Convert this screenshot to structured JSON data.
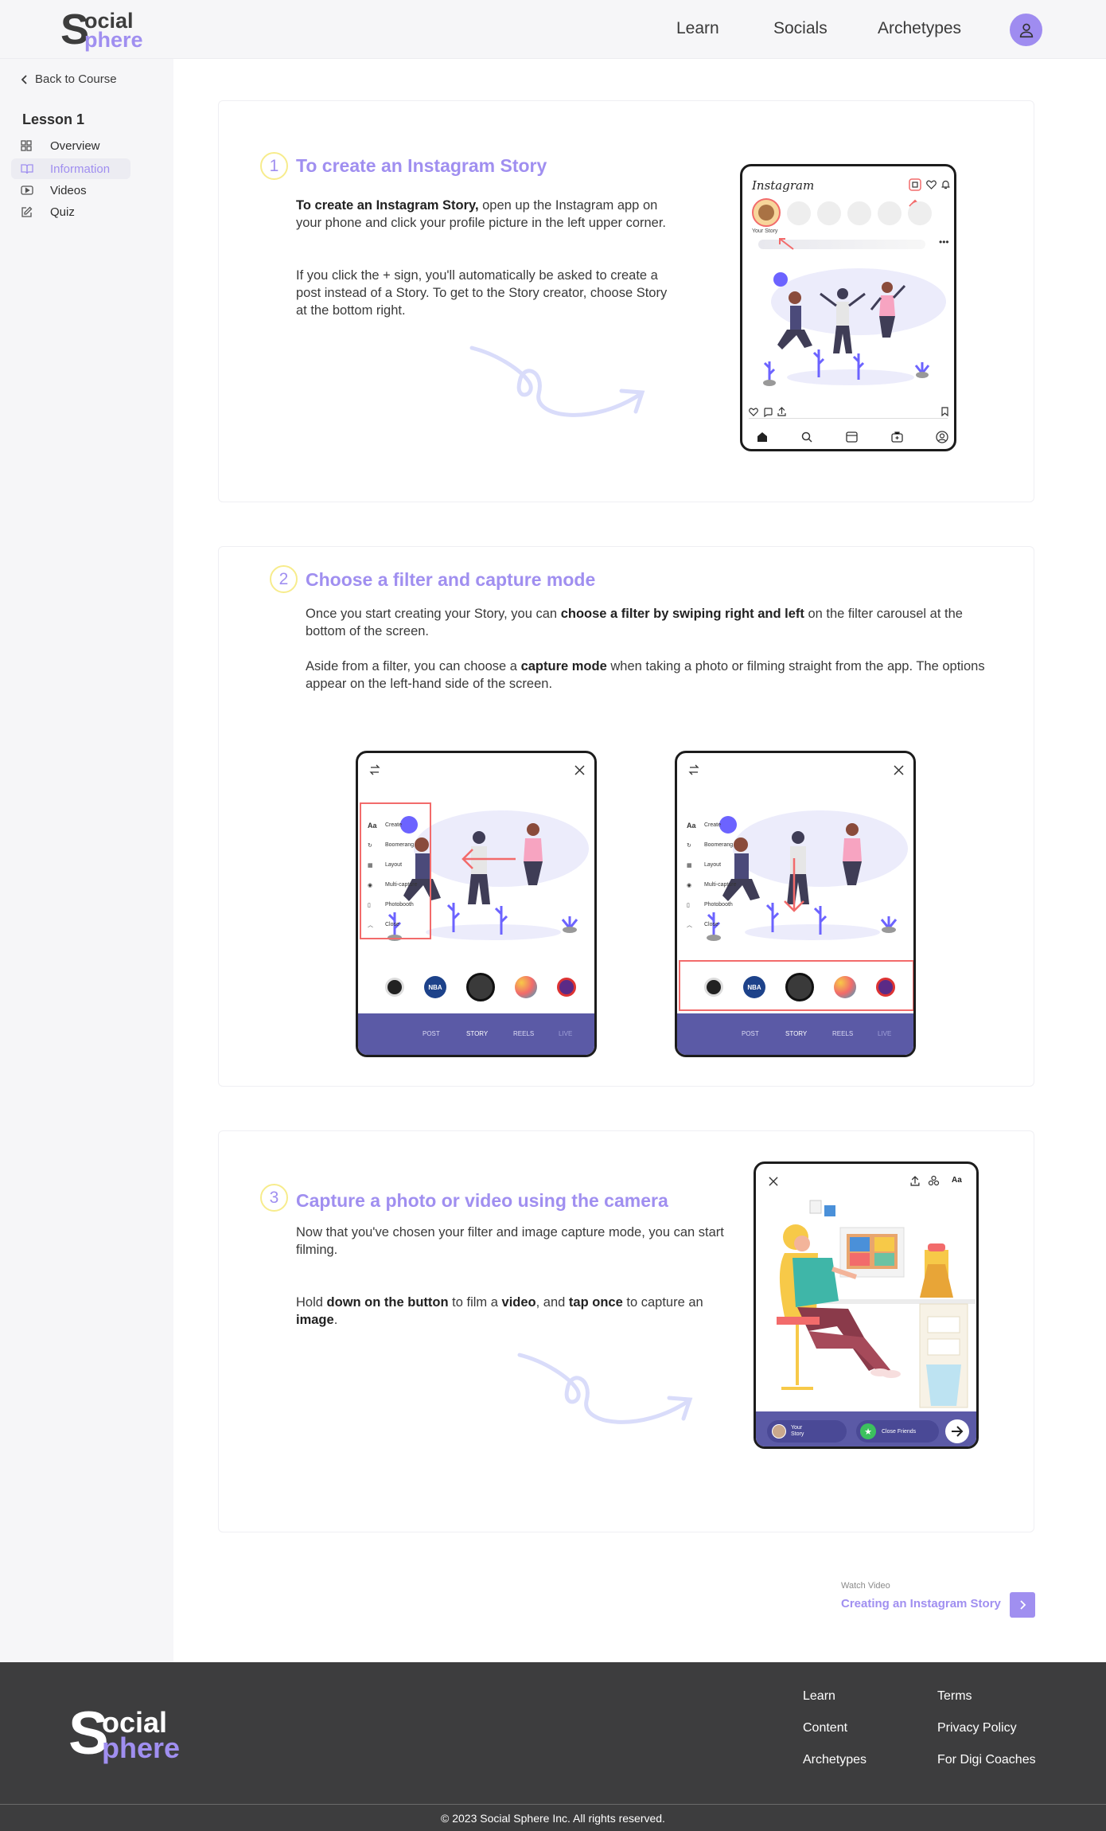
{
  "header": {
    "logo_s": "S",
    "logo_word1": "ocial",
    "logo_word2": "phere",
    "nav": [
      "Learn",
      "Socials",
      "Archetypes"
    ],
    "avatar_icon": "user-icon"
  },
  "sidebar": {
    "back_label": "Back to Course",
    "lesson_title": "Lesson 1",
    "items": [
      {
        "label": "Overview",
        "icon": "grid-icon"
      },
      {
        "label": "Information",
        "icon": "book-icon",
        "active": true
      },
      {
        "label": "Videos",
        "icon": "video-icon"
      },
      {
        "label": "Quiz",
        "icon": "edit-icon"
      }
    ]
  },
  "sections": [
    {
      "number": "1",
      "title": "To create an Instagram Story",
      "p1_bold": "To create an Instagram Story,",
      "p1_rest": " open up the Instagram app on your phone and click your profile picture in the left upper corner.",
      "p2": "If you click the + sign, you'll automatically be asked to create a post instead of a Story. To get to the Story creator, choose Story at the bottom right.",
      "phone": {
        "app_name": "Instagram",
        "story_label": "Your Story"
      }
    },
    {
      "number": "2",
      "title": "Choose a filter and capture mode",
      "p1_a": "Once you start creating your Story, you can ",
      "p1_b": "choose a filter by swiping right and left",
      "p1_c": " on the filter carousel at the bottom of the screen.",
      "p2_a": "Aside from a filter, you can choose a ",
      "p2_b": "capture mode",
      "p2_c": " when taking a photo or filming straight from the app. The options appear on the left-hand side of the screen.",
      "modes": [
        "Create",
        "Boomerang",
        "Layout",
        "Multi-capture",
        "Photobooth",
        "Close"
      ],
      "mode_icons": [
        "Aa"
      ],
      "filter_nba": "NBA",
      "tabs": [
        "POST",
        "STORY",
        "REELS",
        "LIVE"
      ]
    },
    {
      "number": "3",
      "title": "Capture a photo or video using the camera",
      "p1": "Now that you've chosen your filter and image capture mode, you can start filming.",
      "p2_a": "Hold ",
      "p2_b": "down on the button",
      "p2_c": " to film a ",
      "p2_d": "video",
      "p2_e": ", and ",
      "p2_f": "tap once",
      "p2_g": " to capture an ",
      "p2_h": "image",
      "p2_i": ".",
      "phone": {
        "aa": "Aa",
        "your_story_1": "Your",
        "your_story_2": "Story",
        "close_friends": "Close Friends"
      }
    }
  ],
  "next": {
    "kicker": "Watch Video",
    "title": "Creating an Instagram Story"
  },
  "footer": {
    "logo_s": "S",
    "logo_word1": "ocial",
    "logo_word2": "phere",
    "col1": [
      "Learn",
      "Content",
      "Archetypes"
    ],
    "col2": [
      "Terms",
      "Privacy Policy",
      "For Digi Coaches"
    ],
    "copyright": "© 2023 Social Sphere Inc. All rights reserved."
  },
  "colors": {
    "accent": "#a08ff0",
    "number_ring": "#f7ec8c",
    "highlight": "#f26b6b",
    "phone_bar": "#5b5aa6"
  }
}
